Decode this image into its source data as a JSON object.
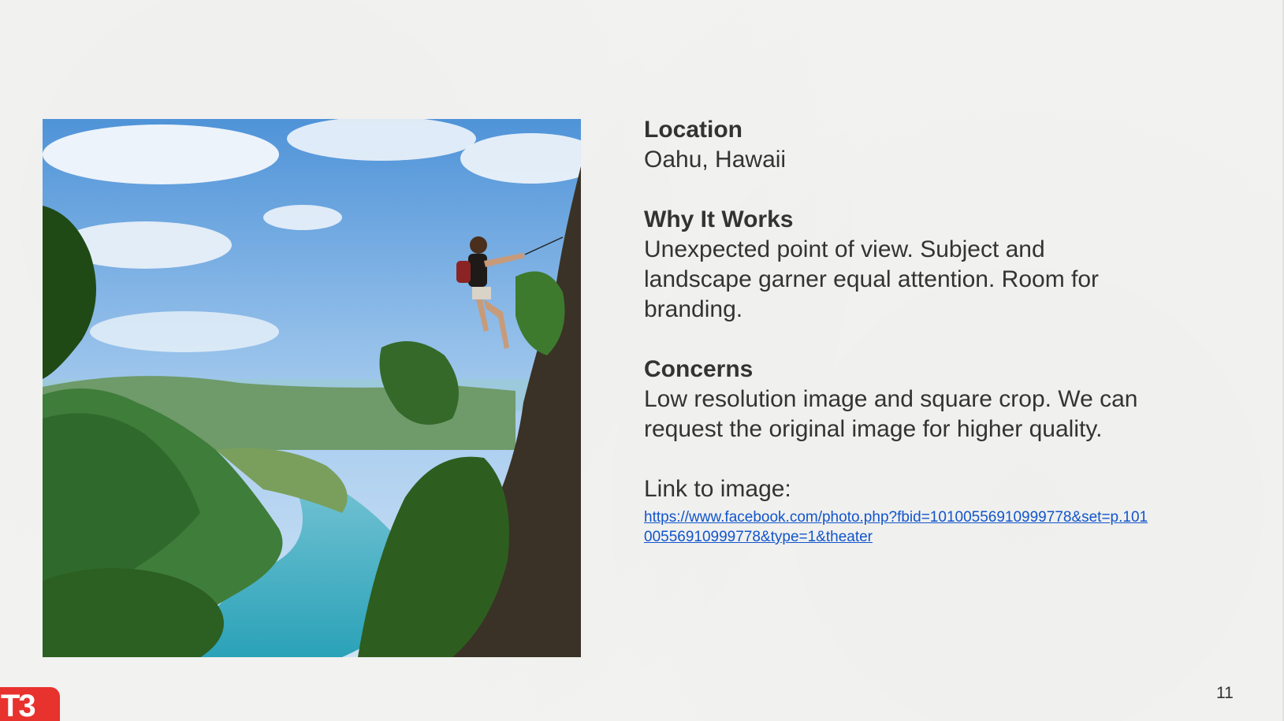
{
  "slide": {
    "location_heading": "Location",
    "location_value": "Oahu, Hawaii",
    "why_heading": "Why It Works",
    "why_text": "Unexpected point of view. Subject and landscape garner equal attention. Room for branding.",
    "concerns_heading": "Concerns",
    "concerns_text": "Low resolution image and square crop. We can request the original image for higher quality.",
    "link_label": "Link to image:",
    "link_url": "https://www.facebook.com/photo.php?fbid=10100556910999778&set=p.10100556910999778&type=1&theater",
    "page_number": "11",
    "logo_text": "T3"
  },
  "colors": {
    "background": "#f3f3f1",
    "text": "#333333",
    "link": "#1155cc",
    "logo": "#e8322d"
  }
}
